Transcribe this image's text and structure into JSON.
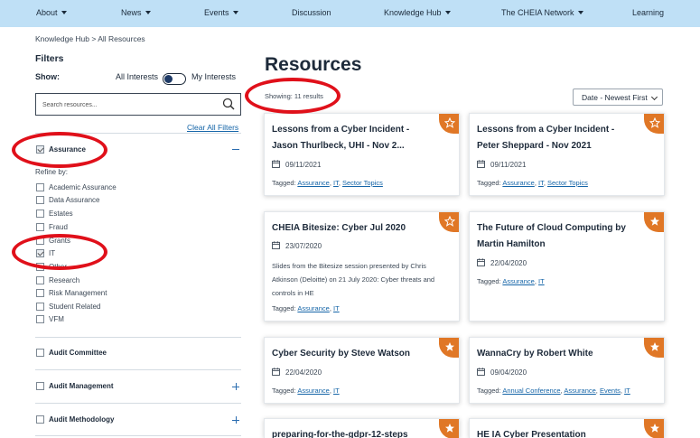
{
  "nav": {
    "about": "About",
    "news": "News",
    "events": "Events",
    "discussion": "Discussion",
    "knowledge_hub": "Knowledge Hub",
    "network": "The CHEIA Network",
    "learning": "Learning"
  },
  "breadcrumb": "Knowledge Hub > All Resources",
  "filters": {
    "title": "Filters",
    "show_label": "Show:",
    "all_interests": "All Interests",
    "my_interests": "My Interests",
    "search_placeholder": "Search resources...",
    "clear_all": "Clear All Filters",
    "groups": [
      {
        "label": "Assurance",
        "checked": true,
        "expanded": true
      },
      {
        "label": "Audit Committee",
        "checked": false,
        "expanded": false
      },
      {
        "label": "Audit Management",
        "checked": false,
        "expanded": false
      },
      {
        "label": "Audit Methodology",
        "checked": false,
        "expanded": false
      }
    ],
    "refine_by": "Refine by:",
    "subitems": [
      {
        "label": "Academic Assurance",
        "checked": false
      },
      {
        "label": "Data Assurance",
        "checked": false
      },
      {
        "label": "Estates",
        "checked": false
      },
      {
        "label": "Fraud",
        "checked": false
      },
      {
        "label": "Grants",
        "checked": false
      },
      {
        "label": "IT",
        "checked": true
      },
      {
        "label": "Other",
        "checked": false
      },
      {
        "label": "Research",
        "checked": false
      },
      {
        "label": "Risk Management",
        "checked": false
      },
      {
        "label": "Student Related",
        "checked": false
      },
      {
        "label": "VFM",
        "checked": false
      }
    ]
  },
  "main": {
    "title": "Resources",
    "showing": "Showing: 11 results",
    "sort": "Date - Newest First"
  },
  "cards": [
    {
      "title": "Lessons from a Cyber Incident - Jason Thurlbeck, UHI - Nov 2...",
      "date": "09/11/2021",
      "tagged_label": "Tagged:",
      "tags": [
        "Assurance",
        "IT",
        "Sector Topics"
      ],
      "starred": false
    },
    {
      "title": "Lessons from a Cyber Incident - Peter Sheppard - Nov 2021",
      "date": "09/11/2021",
      "tagged_label": "Tagged:",
      "tags": [
        "Assurance",
        "IT",
        "Sector Topics"
      ],
      "starred": false
    },
    {
      "title": "CHEIA Bitesize: Cyber Jul 2020",
      "date": "23/07/2020",
      "description": "Slides from the Bitesize session presented by Chris Atkinson (Deloitte) on 21 July 2020: Cyber threats and controls in HE",
      "tagged_label": "Tagged:",
      "tags": [
        "Assurance",
        "IT"
      ],
      "starred": false
    },
    {
      "title": "The Future of Cloud Computing by Martin Hamilton",
      "date": "22/04/2020",
      "tagged_label": "Tagged:",
      "tags": [
        "Assurance",
        "IT"
      ],
      "starred": true
    },
    {
      "title": "Cyber Security by Steve Watson",
      "date": "22/04/2020",
      "tagged_label": "Tagged:",
      "tags": [
        "Assurance",
        "IT"
      ],
      "starred": true
    },
    {
      "title": "WannaCry by Robert White",
      "date": "09/04/2020",
      "tagged_label": "Tagged:",
      "tags": [
        "Annual Conference",
        "Assurance",
        "Events",
        "IT"
      ],
      "starred": true
    },
    {
      "title": "preparing-for-the-gdpr-12-steps",
      "starred": true
    },
    {
      "title": "HE IA Cyber Presentation",
      "starred": true
    }
  ],
  "colors": {
    "nav_bg": "#bfe0f6",
    "accent_orange": "#e07726",
    "link_blue": "#1565a8",
    "annotation_red": "#e0101a"
  }
}
